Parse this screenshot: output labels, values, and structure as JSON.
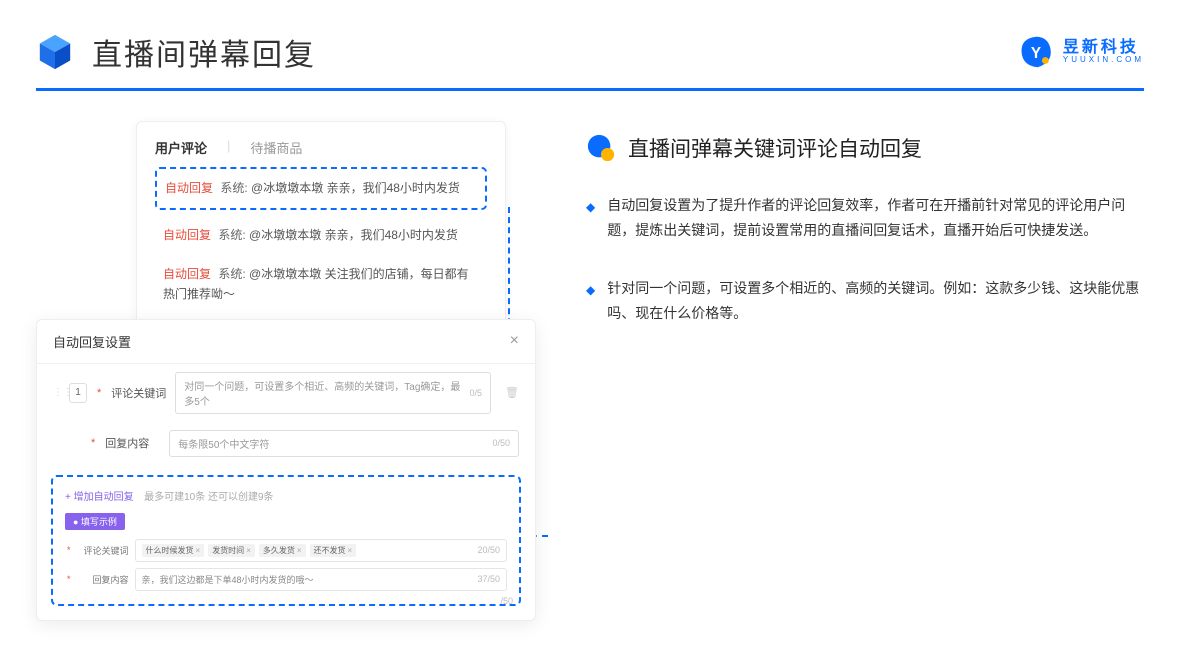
{
  "header": {
    "title": "直播间弹幕回复",
    "brand_name": "昱新科技",
    "brand_url": "YUUXIN.COM"
  },
  "comments": {
    "tab_active": "用户评论",
    "tab_inactive": "待播商品",
    "items": [
      {
        "tag": "自动回复",
        "sys": "系统:",
        "text": "@冰墩墩本墩 亲亲，我们48小时内发货"
      },
      {
        "tag": "自动回复",
        "sys": "系统:",
        "text": "@冰墩墩本墩 亲亲，我们48小时内发货"
      },
      {
        "tag": "自动回复",
        "sys": "系统:",
        "text": "@冰墩墩本墩 关注我们的店铺，每日都有热门推荐呦～"
      }
    ]
  },
  "settings": {
    "title": "自动回复设置",
    "index": "1",
    "keyword_label": "评论关键词",
    "keyword_placeholder": "对同一个问题，可设置多个相近、高频的关键词，Tag确定，最多5个",
    "keyword_count": "0/5",
    "content_label": "回复内容",
    "content_placeholder": "每条限50个中文字符",
    "content_count": "0/50",
    "add_link": "+ 增加自动回复",
    "add_note": "最多可建10条 还可以创建9条",
    "example_badge": "● 填写示例",
    "ex_keyword_label": "评论关键词",
    "ex_tags": [
      "什么时候发货",
      "发货时间",
      "多久发货",
      "还不发货"
    ],
    "ex_keyword_count": "20/50",
    "ex_content_label": "回复内容",
    "ex_content_value": "亲，我们这边都是下单48小时内发货的哦～",
    "ex_content_count": "37/50",
    "stray": "/50"
  },
  "right": {
    "section_title": "直播间弹幕关键词评论自动回复",
    "bullets": [
      "自动回复设置为了提升作者的评论回复效率，作者可在开播前针对常见的评论用户问题，提炼出关键词，提前设置常用的直播间回复话术，直播开始后可快捷发送。",
      "针对同一个问题，可设置多个相近的、高频的关键词。例如：这款多少钱、这块能优惠吗、现在什么价格等。"
    ]
  }
}
